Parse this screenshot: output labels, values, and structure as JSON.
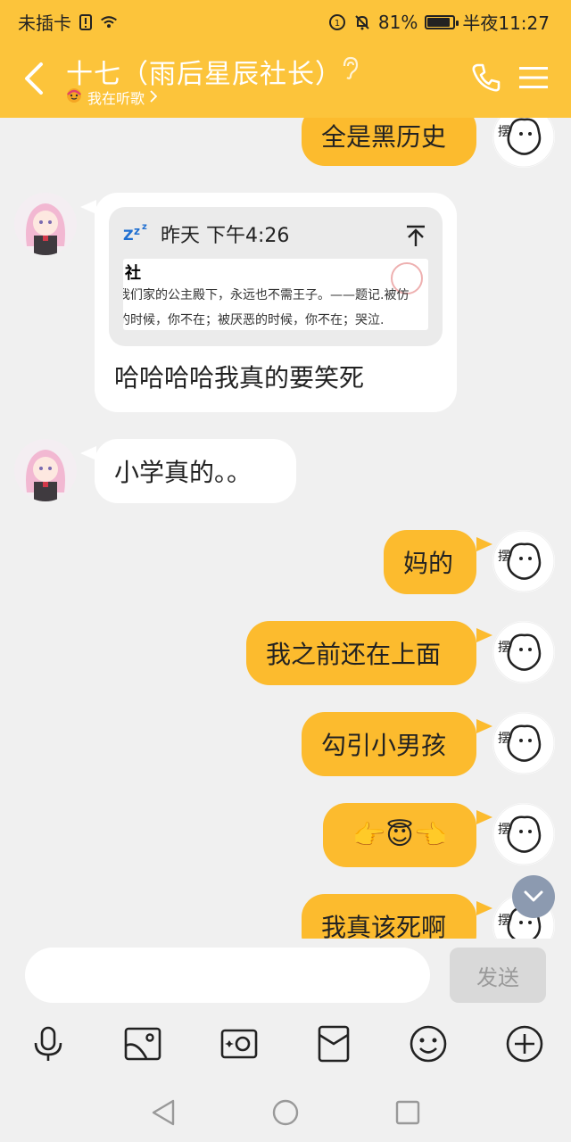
{
  "status_bar": {
    "sim": "未插卡",
    "battery_percent": "81%",
    "battery_level": 0.81,
    "time": "半夜11:27"
  },
  "header": {
    "title": "十七（雨后星辰社长）",
    "subtitle": "我在听歌"
  },
  "messages": [
    {
      "side": "out",
      "text": "全是黑历史"
    },
    {
      "side": "in",
      "text": "哈哈哈哈我真的要笑死",
      "quote": {
        "time": "昨天 下午4:26",
        "doc_title": "社",
        "line1": "我们家的公主殿下，永远也不需王子。——题记.被仿",
        "line2": "的时候，你不在；被厌恶的时候，你不在；哭泣."
      }
    },
    {
      "side": "in",
      "text": "小学真的。。"
    },
    {
      "side": "out",
      "text": "妈的"
    },
    {
      "side": "out",
      "text": "我之前还在上面"
    },
    {
      "side": "out",
      "text": "勾引小男孩"
    },
    {
      "side": "out",
      "text": "👉😇👈"
    },
    {
      "side": "out",
      "text": "我真该死啊"
    }
  ],
  "input": {
    "value": "",
    "placeholder": "",
    "send_label": "发送"
  },
  "colors": {
    "accent": "#fcc43b",
    "bubble_out": "#fcbb2e",
    "bubble_in": "#ffffff",
    "background": "#f0f0f0"
  },
  "icons": [
    "back-icon",
    "ear-icon",
    "phone-icon",
    "menu-icon",
    "microphone-icon",
    "image-icon",
    "camera-icon",
    "red-packet-icon",
    "emoji-icon",
    "plus-icon",
    "scroll-down-icon",
    "nav-back-icon",
    "nav-home-icon",
    "nav-recents-icon"
  ]
}
